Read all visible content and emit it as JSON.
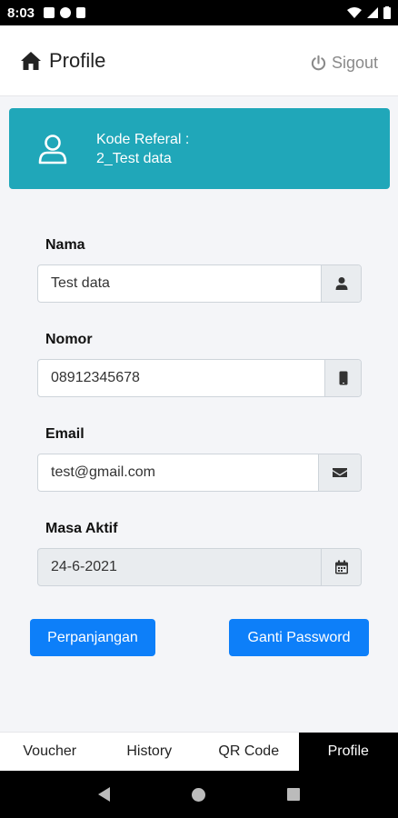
{
  "status": {
    "time": "8:03"
  },
  "header": {
    "title": "Profile",
    "signout_label": "Sigout"
  },
  "referral": {
    "label": "Kode Referal :",
    "code": "2_Test data"
  },
  "form": {
    "nama": {
      "label": "Nama",
      "value": "Test data"
    },
    "nomor": {
      "label": "Nomor",
      "value": "08912345678"
    },
    "email": {
      "label": "Email",
      "value": "test@gmail.com"
    },
    "masa_aktif": {
      "label": "Masa Aktif",
      "value": "24-6-2021"
    }
  },
  "buttons": {
    "extend": "Perpanjangan",
    "change_password": "Ganti Password"
  },
  "tabs": [
    {
      "label": "Voucher"
    },
    {
      "label": "History"
    },
    {
      "label": "QR Code"
    },
    {
      "label": "Profile"
    }
  ],
  "colors": {
    "accent": "#20a7b9",
    "primary": "#0d7ff9",
    "active_tab": "#000000"
  }
}
